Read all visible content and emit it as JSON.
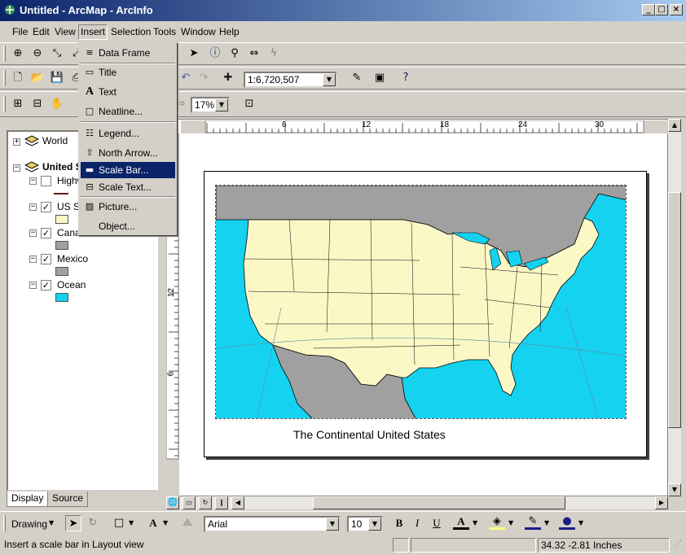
{
  "window": {
    "title": "Untitled - ArcMap - ArcInfo",
    "minimize": "_",
    "maximize": "□",
    "close": "×"
  },
  "menu": {
    "items": [
      "File",
      "Edit",
      "View",
      "Insert",
      "Selection",
      "Tools",
      "Window",
      "Help"
    ],
    "active": "Insert"
  },
  "insert_menu": {
    "items": [
      {
        "label": "Data Frame",
        "icon": "data-frame-icon"
      },
      {
        "label": "Title",
        "icon": "title-icon"
      },
      {
        "label": "Text",
        "icon": "text-icon"
      },
      {
        "label": "Neatline...",
        "icon": "neatline-icon"
      },
      {
        "label": "Legend...",
        "icon": "legend-icon"
      },
      {
        "label": "North Arrow...",
        "icon": "north-arrow-icon"
      },
      {
        "label": "Scale Bar...",
        "icon": "scale-bar-icon"
      },
      {
        "label": "Scale Text...",
        "icon": "scale-text-icon"
      },
      {
        "label": "Picture...",
        "icon": "picture-icon"
      },
      {
        "label": "Object...",
        "icon": "object-icon"
      }
    ],
    "selected": "Scale Bar..."
  },
  "toolbar": {
    "scale_value": "1:6,720,507",
    "zoom_value": "17%"
  },
  "toc": {
    "world": "World",
    "united_states": "United S",
    "layers": [
      {
        "name": "Highw",
        "checked": false,
        "color": "#6b1a1a"
      },
      {
        "name": "US St",
        "checked": true,
        "color": "#fbf8c6"
      },
      {
        "name": "Cana",
        "checked": true,
        "color": "#a0a0a0"
      },
      {
        "name": "Mexico",
        "checked": true,
        "color": "#a0a0a0"
      },
      {
        "name": "Ocean",
        "checked": true,
        "color": "#14d2f0"
      }
    ],
    "tabs": [
      "Display",
      "Source"
    ]
  },
  "ruler": {
    "h_ticks": [
      "6",
      "12",
      "18",
      "24",
      "30"
    ],
    "v_ticks": [
      "12",
      "6"
    ]
  },
  "layout": {
    "map_title": "The Continental United States"
  },
  "drawing": {
    "label": "Drawing",
    "font": "Arial",
    "size": "10",
    "bold": "B",
    "italic": "I",
    "underline": "U"
  },
  "status": {
    "message": "Insert a scale bar in Layout view",
    "coords": "34.32  -2.81 Inches"
  },
  "colors": {
    "ocean": "#14d2f0",
    "land_us": "#fbf8c6",
    "land_other": "#a0a0a0",
    "selection": "#0a246a"
  }
}
